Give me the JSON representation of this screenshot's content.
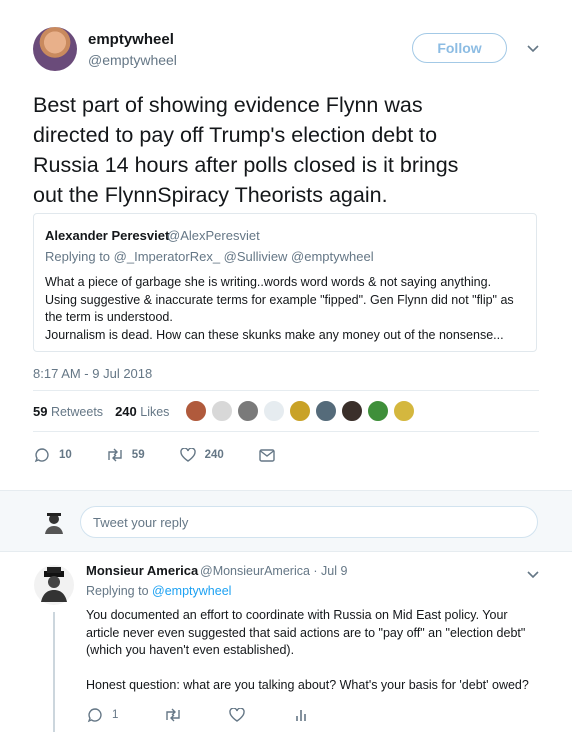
{
  "colors": {
    "accent": "#1da1f2",
    "muted": "#657786",
    "text": "#14171a",
    "border": "#e6ecf0",
    "bg_alt": "#f5f8fa"
  },
  "tweet": {
    "author_name": "emptywheel",
    "author_handle": "@emptywheel",
    "follow_label": "Follow",
    "text": "Best part of showing evidence Flynn was\ndirected to pay off Trump's election debt to\nRussia 14 hours after polls closed is it brings\nout the FlynnSpiracy Theorists again.",
    "timestamp": "8:17 AM - 9 Jul 2018",
    "retweets_count": "59",
    "retweets_label": "Retweets",
    "likes_count": "240",
    "likes_label": "Likes",
    "actions": {
      "replies": "10",
      "retweets": "59",
      "likes": "240"
    }
  },
  "quote": {
    "author_name": "Alexander Peresviet",
    "author_handle": "@AlexPeresviet",
    "replying_to": "Replying to @_ImperatorRex_ @Sulliview @emptywheel",
    "text": "What a piece of garbage she is writing..words word words & not saying anything.\nUsing suggestive & inaccurate terms for example \"fipped\". Gen Flynn did not \"flip\" as\nthe term is understood.\nJournalism is dead. How can these skunks make any money out of the nonsense..."
  },
  "reply_box": {
    "placeholder": "Tweet your reply"
  },
  "reply": {
    "author_name": "Monsieur America",
    "author_handle": "@MonsieurAmerica · Jul 9",
    "replying_prefix": "Replying to",
    "replying_to": "@emptywheel",
    "text": "You documented an effort to coordinate with Russia on Mid East policy. Your\narticle never even suggested that said actions are to \"pay off\" an \"election debt\"\n(which you haven't even established).\n\nHonest question: what are you talking about? What's your basis for 'debt' owed?",
    "reply_count": "1"
  }
}
